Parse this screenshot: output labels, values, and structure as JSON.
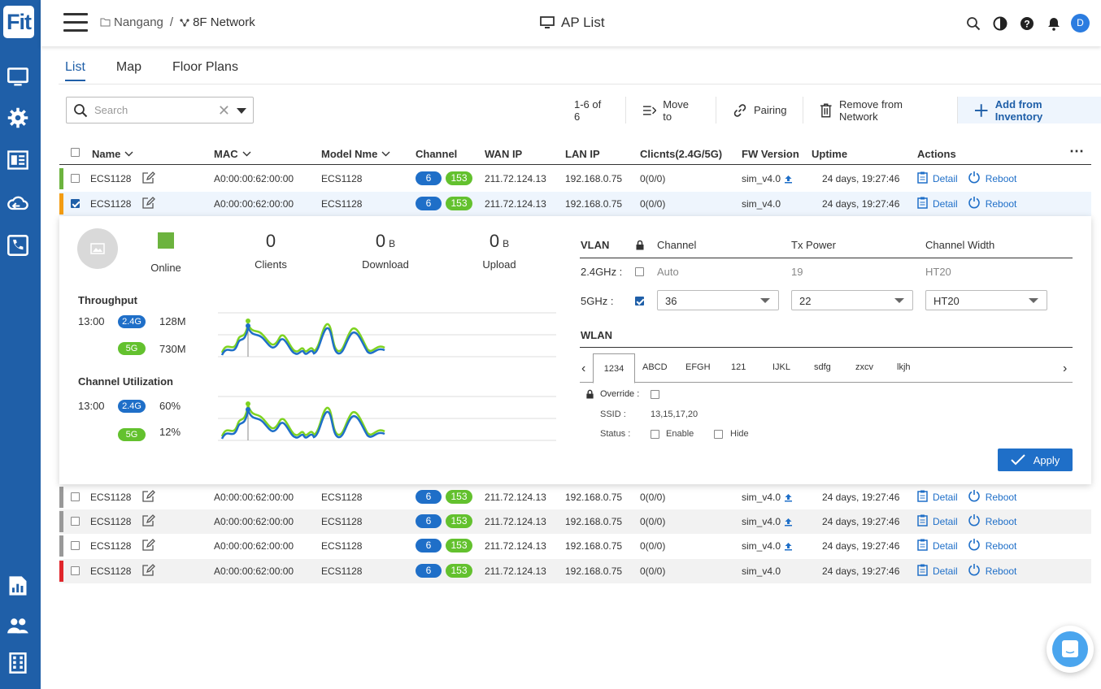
{
  "brand": {
    "logo_text": "Fit",
    "accent": "#1f5fa8"
  },
  "header": {
    "breadcrumb_site": "Nangang",
    "breadcrumb_sep": "/",
    "breadcrumb_network": "8F Network",
    "title": "AP List",
    "avatar_initial": "D"
  },
  "tabs": [
    {
      "label": "List"
    },
    {
      "label": "Map"
    },
    {
      "label": "Floor Plans"
    }
  ],
  "search": {
    "placeholder": "Search"
  },
  "toolbar": {
    "count": "1-6 of 6",
    "move_to": "Move to",
    "pairing": "Pairing",
    "remove": "Remove from Network",
    "add": "Add from Inventory"
  },
  "columns": {
    "name": "Name",
    "mac": "MAC",
    "model": "Model Nme",
    "channel": "Channel",
    "wan": "WAN IP",
    "lan": "LAN IP",
    "clients": "Clicnts(2.4G/5G)",
    "fw": "FW Version",
    "uptime": "Uptime",
    "actions": "Actions"
  },
  "rows": [
    {
      "name": "ECS1128",
      "mac": "A0:00:00:62:00:00",
      "model": "ECS1128",
      "ch24": "6",
      "ch5": "153",
      "wan": "211.72.124.13",
      "lan": "192.168.0.75",
      "clients": "0(0/0)",
      "fw": "sim_v4.0",
      "uptime": "24 days, 19:27:46",
      "detail": "Detail",
      "reboot": "Reboot",
      "status_color": "#6cb33e"
    },
    {
      "name": "ECS1128",
      "mac": "A0:00:00:62:00:00",
      "model": "ECS1128",
      "ch24": "6",
      "ch5": "153",
      "wan": "211.72.124.13",
      "lan": "192.168.0.75",
      "clients": "0(0/0)",
      "fw": "sim_v4.0",
      "uptime": "24 days, 19:27:46",
      "detail": "Detail",
      "reboot": "Reboot",
      "status_color": "#f39c12"
    },
    {
      "name": "ECS1128",
      "mac": "A0:00:00:62:00:00",
      "model": "ECS1128",
      "ch24": "6",
      "ch5": "153",
      "wan": "211.72.124.13",
      "lan": "192.168.0.75",
      "clients": "0(0/0)",
      "fw": "sim_v4.0",
      "uptime": "24 days, 19:27:46",
      "detail": "Detail",
      "reboot": "Reboot",
      "status_color": "#999999"
    },
    {
      "name": "ECS1128",
      "mac": "A0:00:00:62:00:00",
      "model": "ECS1128",
      "ch24": "6",
      "ch5": "153",
      "wan": "211.72.124.13",
      "lan": "192.168.0.75",
      "clients": "0(0/0)",
      "fw": "sim_v4.0",
      "uptime": "24 days, 19:27:46",
      "detail": "Detail",
      "reboot": "Reboot",
      "status_color": "#999999"
    },
    {
      "name": "ECS1128",
      "mac": "A0:00:00:62:00:00",
      "model": "ECS1128",
      "ch24": "6",
      "ch5": "153",
      "wan": "211.72.124.13",
      "lan": "192.168.0.75",
      "clients": "0(0/0)",
      "fw": "sim_v4.0",
      "uptime": "24 days, 19:27:46",
      "detail": "Detail",
      "reboot": "Reboot",
      "status_color": "#999999"
    },
    {
      "name": "ECS1128",
      "mac": "A0:00:00:62:00:00",
      "model": "ECS1128",
      "ch24": "6",
      "ch5": "153",
      "wan": "211.72.124.13",
      "lan": "192.168.0.75",
      "clients": "0(0/0)",
      "fw": "sim_v4.0",
      "uptime": "24 days, 19:27:46",
      "detail": "Detail",
      "reboot": "Reboot",
      "status_color": "#e0262b"
    }
  ],
  "detail": {
    "online_label": "Online",
    "clients_value": "0",
    "clients_label": "Clients",
    "download_value": "0",
    "download_unit": "B",
    "download_label": "Download",
    "upload_value": "0",
    "upload_unit": "B",
    "upload_label": "Upload",
    "throughput_title": "Throughput",
    "throughput_time": "13:00",
    "throughput_24": "128M",
    "throughput_5": "730M",
    "util_title": "Channel Utilization",
    "util_time": "13:00",
    "util_24": "60%",
    "util_5": "12%",
    "band_24": "2.4G",
    "band_5": "5G",
    "vlan_title": "VLAN",
    "channel_h": "Channel",
    "txpower_h": "Tx Power",
    "width_h": "Channel Width",
    "r24_label": "2.4GHz :",
    "r24_channel": "Auto",
    "r24_power": "19",
    "r24_width": "HT20",
    "r5_label": "5GHz :",
    "r5_channel": "36",
    "r5_power": "22",
    "r5_width": "HT20",
    "wlan_title": "WLAN",
    "wlan_tabs": [
      "1234",
      "ABCD",
      "EFGH",
      "121",
      "IJKL",
      "sdfg",
      "zxcv",
      "lkjh"
    ],
    "override_label": "Override :",
    "ssid_label": "SSID :",
    "ssid_value": "13,15,17,20",
    "status_label": "Status :",
    "enable_label": "Enable",
    "hide_label": "Hide",
    "apply_label": "Apply"
  }
}
